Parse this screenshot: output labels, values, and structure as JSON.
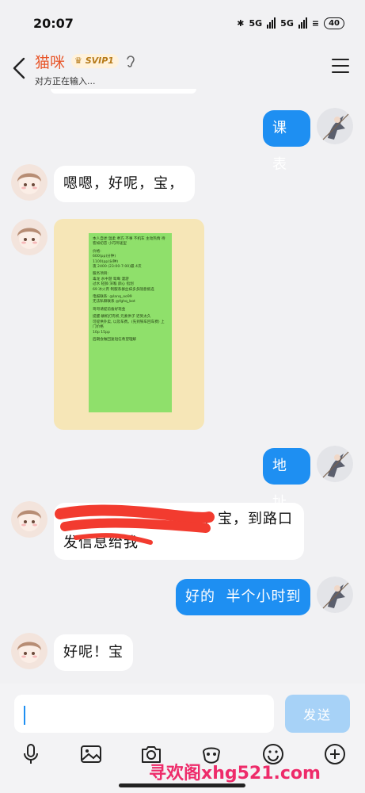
{
  "status_bar": {
    "time": "20:07",
    "network_1": "5G",
    "network_2": "5G",
    "battery": "40"
  },
  "header": {
    "contact_name": "猫咪",
    "vip_badge": "SVIP1",
    "status_text": "对方正在输入..."
  },
  "messages": [
    {
      "side": "out",
      "text": "课表"
    },
    {
      "side": "in",
      "text": "嗯嗯，好呢，宝，"
    },
    {
      "side": "in",
      "type": "image"
    },
    {
      "side": "out",
      "text": "地址"
    },
    {
      "side": "in",
      "text_line1": "，宝，到路口",
      "text_line2": "发信息给我"
    },
    {
      "side": "out",
      "text": "好的  半个小时到"
    },
    {
      "side": "in",
      "text": "好呢！宝"
    }
  ],
  "poster_lines": [
    "本人自述:温柔 乖巧 不事 不机车 主动热情 待客如初恋 小巧玲珑型",
    "价格:\n600(pp)分钟)\n1100(pp)分钟)\n夜 2400 (23:00-7:00)最 4次",
    "服务项目:\n毒龙 水中游 鸳鸯 漫游\n过水 轻舔 深喉 颜心 指划\n69 冰火宵 制服系群丝袜多多随意挑选",
    "电报联系: @lanq_oo99\n无法私聊联系 @fghq_bot",
    "哥哥请提前备好现金",
    "提醒:酬机打有机 元素供子 迟到太久\n可提供外卖, 以及车费。(先到铁车回车费) 上门价格\n10p 15pp",
    "后期会做回复短信希望理解"
  ],
  "composer": {
    "input_placeholder": "",
    "send_label": "发送"
  },
  "watermark": "寻欢阁xhg521.com",
  "colors": {
    "accent": "#1e8ff2",
    "name_color": "#e8562a",
    "send_disabled": "#a7d2f7"
  }
}
